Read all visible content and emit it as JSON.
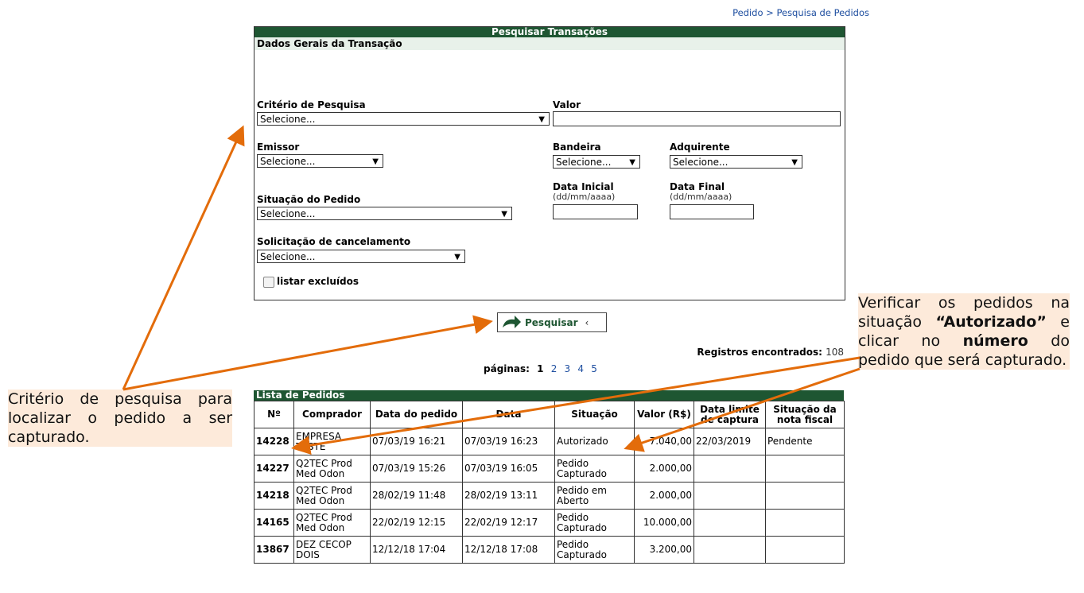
{
  "breadcrumb": {
    "part1": "Pedido",
    "sep": " > ",
    "part2": "Pesquisa de Pedidos"
  },
  "form": {
    "title": "Pesquisar Transações",
    "section": "Dados Gerais da Transação",
    "criterio_label": "Critério de Pesquisa",
    "criterio_value": "Selecione...",
    "valor_label": "Valor",
    "emissor_label": "Emissor",
    "emissor_value": "Selecione...",
    "bandeira_label": "Bandeira",
    "bandeira_value": "Selecione...",
    "adquirente_label": "Adquirente",
    "adquirente_value": "Selecione...",
    "situacao_label": "Situação do Pedido",
    "situacao_value": "Selecione...",
    "data_inicial_label": "Data Inicial",
    "data_inicial_hint": "(dd/mm/aaaa)",
    "data_final_label": "Data Final",
    "data_final_hint": "(dd/mm/aaaa)",
    "cancelamento_label": "Solicitação de cancelamento",
    "cancelamento_value": "Selecione...",
    "listar_excluidos": "listar excluídos"
  },
  "search_button": "Pesquisar",
  "registros": {
    "label": "Registros encontrados:",
    "count": "108"
  },
  "paginas": {
    "label": "páginas:",
    "pages": [
      "1",
      "2",
      "3",
      "4",
      "5"
    ]
  },
  "list": {
    "title": "Lista de Pedidos",
    "headers": [
      "Nº",
      "Comprador",
      "Data do pedido",
      "Data",
      "Situação",
      "Valor (R$)",
      "Data limite de captura",
      "Situação da nota fiscal"
    ],
    "rows": [
      [
        "14228",
        "EMPRESA TESTE",
        "07/03/19 16:21",
        "07/03/19 16:23",
        "Autorizado",
        "7.040,00",
        "22/03/2019",
        "Pendente"
      ],
      [
        "14227",
        "Q2TEC Prod Med Odon",
        "07/03/19 15:26",
        "07/03/19 16:05",
        "Pedido Capturado",
        "2.000,00",
        "",
        ""
      ],
      [
        "14218",
        "Q2TEC Prod Med Odon",
        "28/02/19 11:48",
        "28/02/19 13:11",
        "Pedido em Aberto",
        "2.000,00",
        "",
        ""
      ],
      [
        "14165",
        "Q2TEC Prod Med Odon",
        "22/02/19 12:15",
        "22/02/19 12:17",
        "Pedido Capturado",
        "10.000,00",
        "",
        ""
      ],
      [
        "13867",
        "DEZ CECOP DOIS",
        "12/12/18 17:04",
        "12/12/18 17:08",
        "Pedido Capturado",
        "3.200,00",
        "",
        ""
      ]
    ]
  },
  "annotations": {
    "left": "Critério de pesquisa para localizar o pedido a ser capturado.",
    "right_1": "Verificar os pedidos na situação ",
    "right_2": "“Autorizado”",
    "right_3": " e clicar no ",
    "right_4": "número",
    "right_5": " do pedido que será capturado."
  },
  "colors": {
    "header_green": "#1e5632",
    "note_bg": "#fdeada",
    "arrow": "#e36c0a",
    "link": "#1f4fa0"
  }
}
